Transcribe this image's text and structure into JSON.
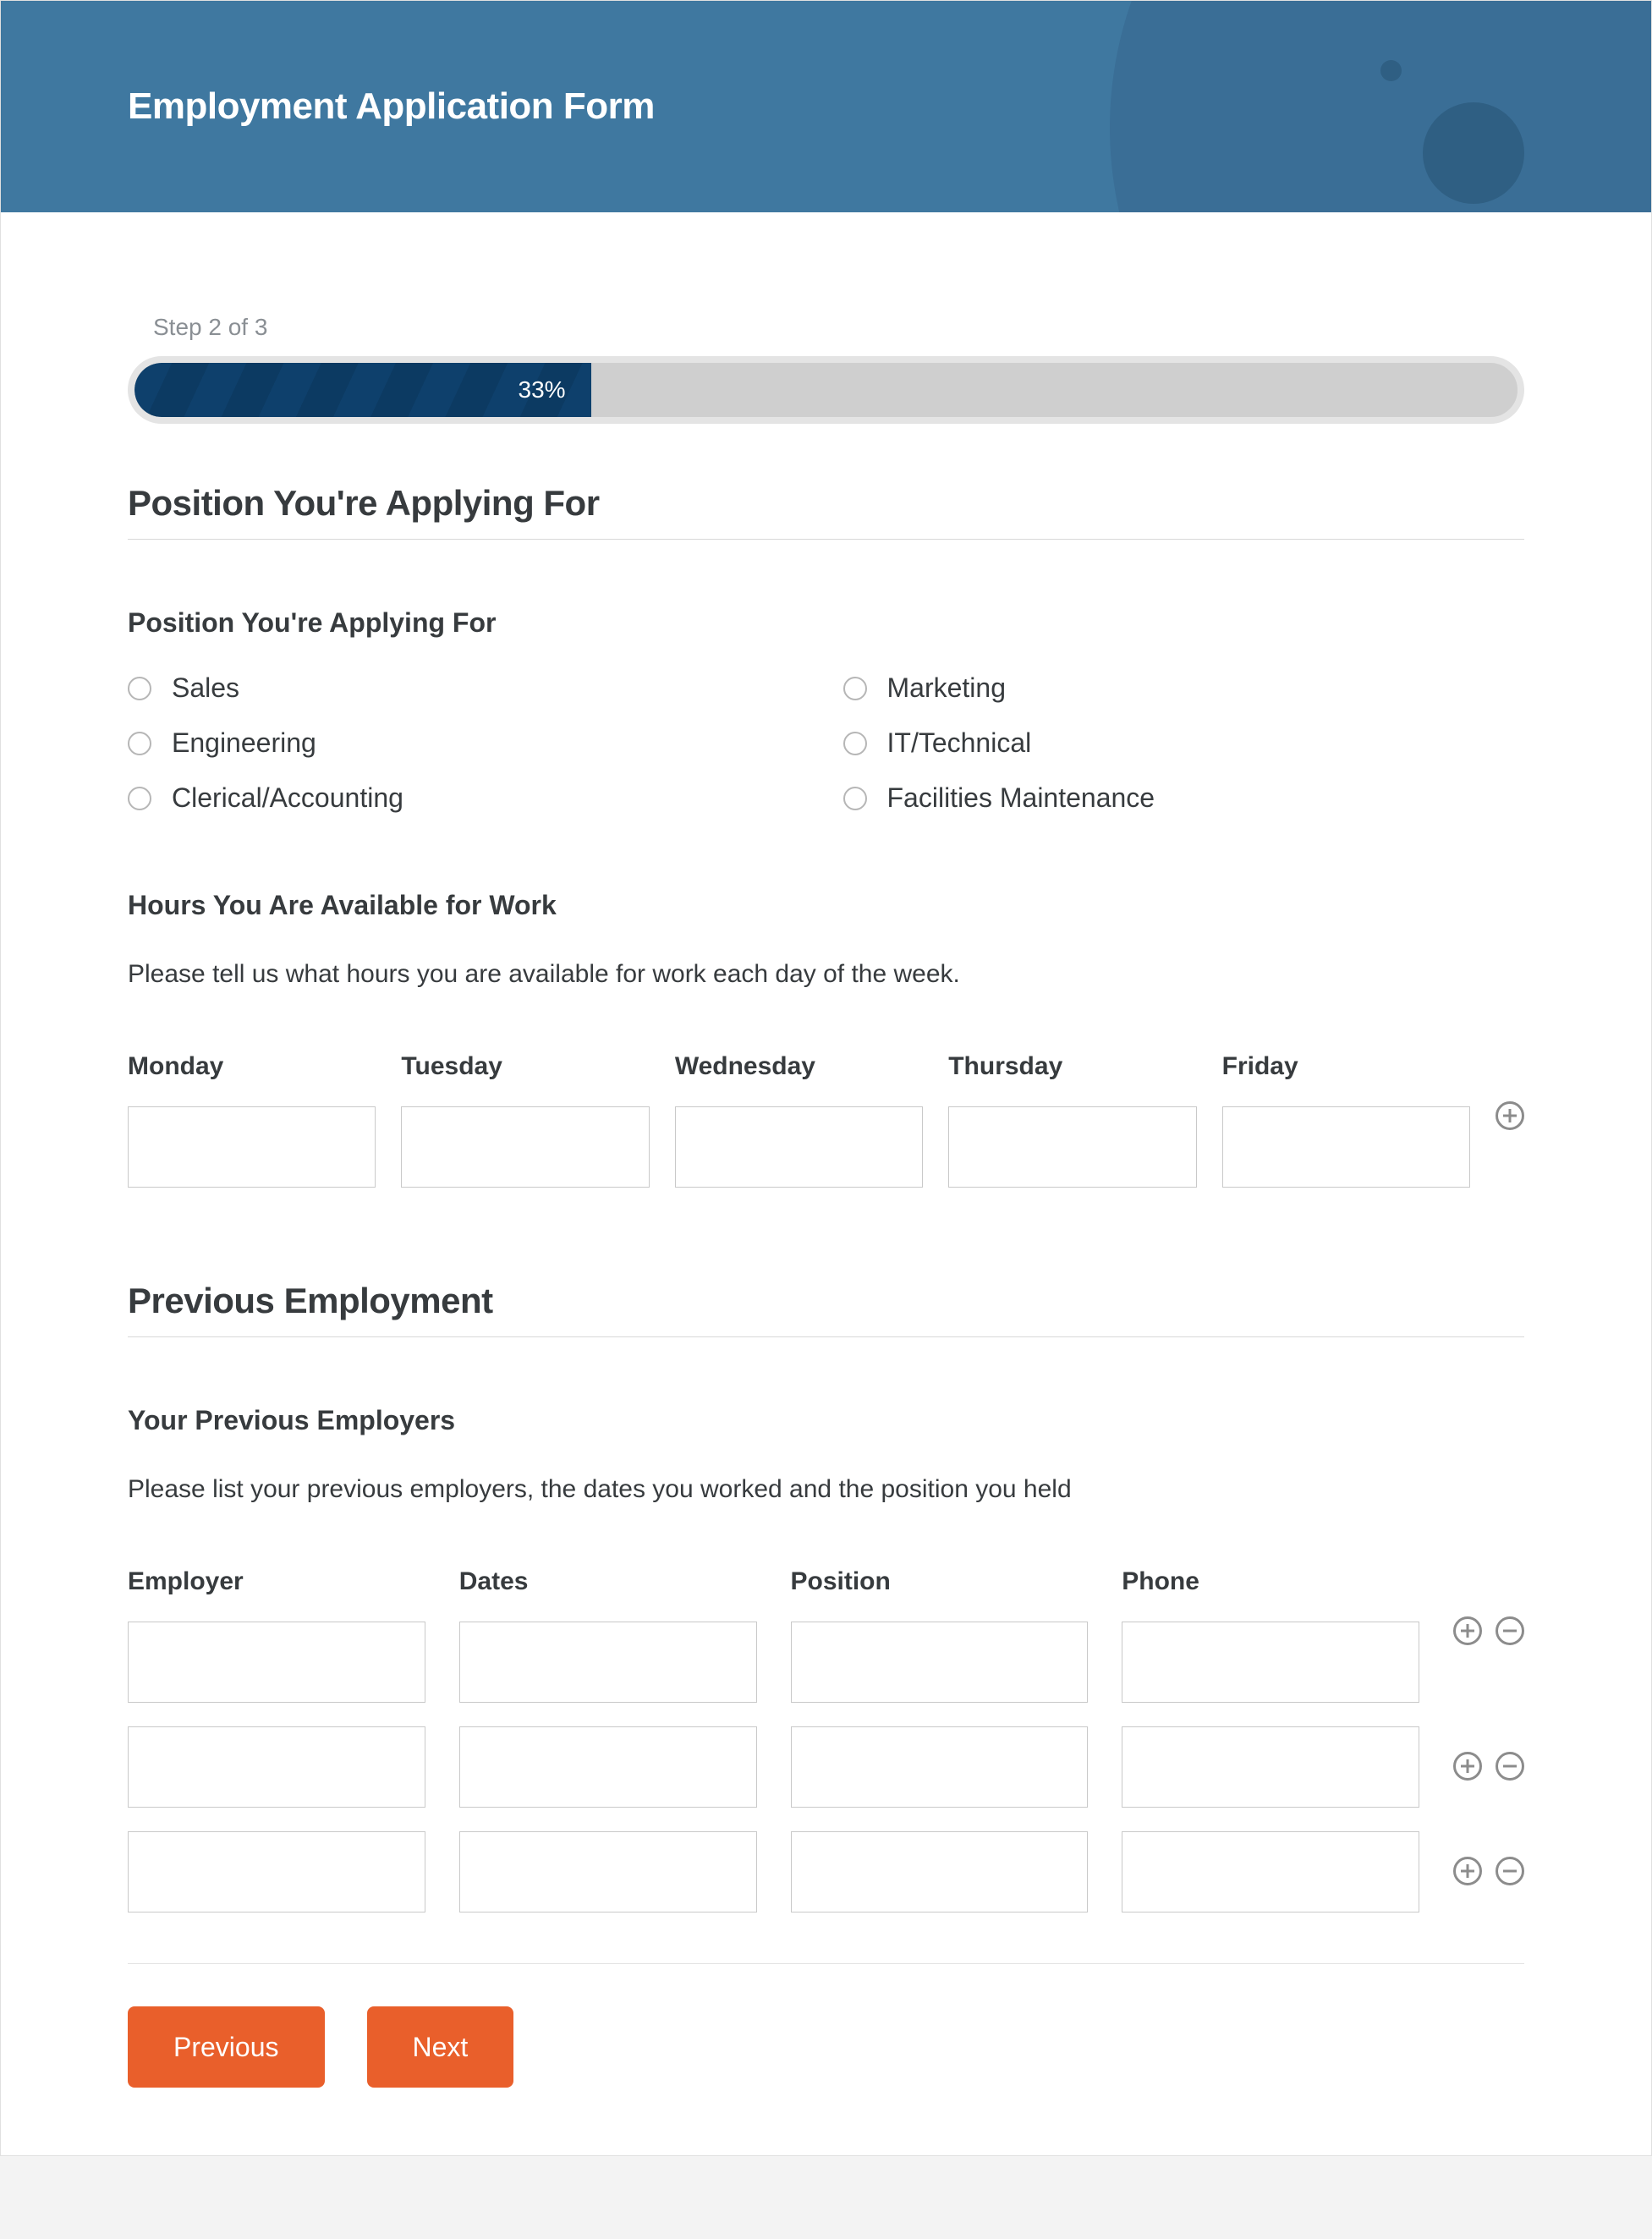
{
  "header": {
    "title": "Employment Application Form"
  },
  "progress": {
    "step_label": "Step 2 of 3",
    "percent_text": "33%",
    "percent": 33
  },
  "section_position": {
    "heading": "Position You're Applying For",
    "field_label": "Position You're Applying For",
    "options": [
      "Sales",
      "Marketing",
      "Engineering",
      "IT/Technical",
      "Clerical/Accounting",
      "Facilities Maintenance"
    ]
  },
  "section_hours": {
    "field_label": "Hours You Are Available for Work",
    "hint": "Please tell us what hours you are available for work each day of the week.",
    "columns": [
      "Monday",
      "Tuesday",
      "Wednesday",
      "Thursday",
      "Friday"
    ],
    "rows": [
      {
        "values": [
          "",
          "",
          "",
          "",
          ""
        ]
      }
    ]
  },
  "section_prev": {
    "heading": "Previous Employment",
    "field_label": "Your Previous Employers",
    "hint": "Please list your previous employers, the dates you worked and the position you held",
    "columns": [
      "Employer",
      "Dates",
      "Position",
      "Phone"
    ],
    "rows": [
      {
        "values": [
          "",
          "",
          "",
          ""
        ]
      },
      {
        "values": [
          "",
          "",
          "",
          ""
        ]
      },
      {
        "values": [
          "",
          "",
          "",
          ""
        ]
      }
    ]
  },
  "buttons": {
    "previous": "Previous",
    "next": "Next"
  }
}
